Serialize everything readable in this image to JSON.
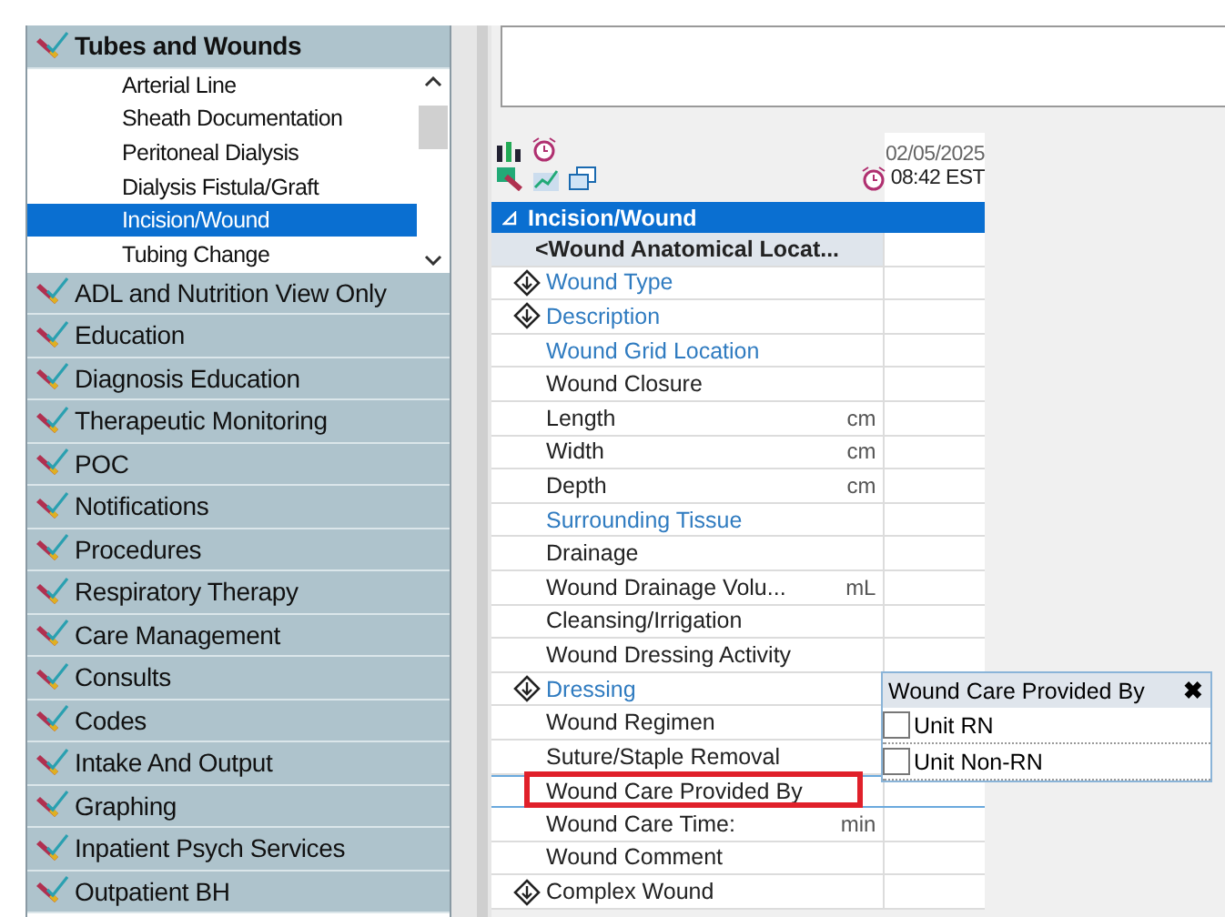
{
  "navigator": {
    "header": "Tubes and Wounds",
    "items": [
      {
        "label": "Arterial Line",
        "selected": false
      },
      {
        "label": "Sheath Documentation",
        "selected": false
      },
      {
        "label": "Peritoneal Dialysis",
        "selected": false
      },
      {
        "label": "Dialysis Fistula/Graft",
        "selected": false
      },
      {
        "label": "Incision/Wound",
        "selected": true
      },
      {
        "label": "Tubing Change",
        "selected": false
      }
    ],
    "bands": [
      "ADL and Nutrition View Only",
      "Education",
      "Diagnosis Education",
      "Therapeutic Monitoring",
      "POC",
      "Notifications",
      "Procedures",
      "Respiratory Therapy",
      "Care Management",
      "Consults",
      "Codes",
      "Intake And Output",
      "Graphing",
      "Inpatient Psych Services",
      "Outpatient BH"
    ]
  },
  "flowsheet": {
    "date": "02/05/2025",
    "time": "08:42 EST",
    "section": "Incision/Wound",
    "group": "<Wound Anatomical Locat...",
    "rows": [
      {
        "label": "Wound Type",
        "link": true,
        "marker": true,
        "highlighted": false
      },
      {
        "label": "Description",
        "link": true,
        "marker": true,
        "highlighted": false
      },
      {
        "label": "Wound Grid Location",
        "link": true,
        "marker": false,
        "highlighted": false
      },
      {
        "label": "Wound Closure",
        "link": false,
        "marker": false,
        "highlighted": false
      },
      {
        "label": "Length",
        "unit": "cm",
        "link": false,
        "marker": false,
        "highlighted": false
      },
      {
        "label": "Width",
        "unit": "cm",
        "link": false,
        "marker": false,
        "highlighted": false
      },
      {
        "label": "Depth",
        "unit": "cm",
        "link": false,
        "marker": false,
        "highlighted": false
      },
      {
        "label": "Surrounding Tissue",
        "link": true,
        "marker": false,
        "highlighted": false
      },
      {
        "label": "Drainage",
        "link": false,
        "marker": false,
        "highlighted": false
      },
      {
        "label": "Wound Drainage Volu...",
        "unit": "mL",
        "link": false,
        "marker": false,
        "highlighted": false
      },
      {
        "label": "Cleansing/Irrigation",
        "link": false,
        "marker": false,
        "highlighted": false
      },
      {
        "label": "Wound Dressing Activity",
        "link": false,
        "marker": false,
        "highlighted": false
      },
      {
        "label": "Dressing",
        "link": true,
        "marker": true,
        "highlighted": false
      },
      {
        "label": "Wound Regimen",
        "link": false,
        "marker": false,
        "highlighted": false
      },
      {
        "label": "Suture/Staple Removal",
        "link": false,
        "marker": false,
        "highlighted": false
      },
      {
        "label": "Wound Care Provided By",
        "link": false,
        "marker": false,
        "highlighted": true
      },
      {
        "label": "Wound Care Time:",
        "unit": "min",
        "link": false,
        "marker": false,
        "highlighted": false
      },
      {
        "label": "Wound Comment",
        "link": false,
        "marker": false,
        "highlighted": false
      },
      {
        "label": "Complex Wound",
        "link": false,
        "marker": true,
        "highlighted": false
      }
    ]
  },
  "popup": {
    "title": "Wound Care Provided By",
    "close": "✖",
    "options": [
      {
        "label": "Unit RN",
        "checked": false
      },
      {
        "label": "Unit Non-RN",
        "checked": false
      }
    ]
  }
}
